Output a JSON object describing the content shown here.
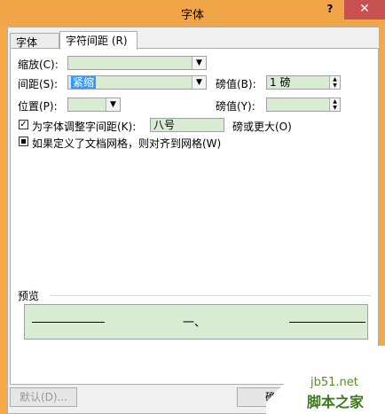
{
  "window": {
    "title": "字体",
    "help": "?",
    "close": "✕"
  },
  "tabs": [
    {
      "label": "字体 (N)"
    },
    {
      "label": "字符间距 (R)"
    }
  ],
  "fields": {
    "scale_label": "缩放(C):",
    "scale_value": "",
    "spacing_label": "间距(S):",
    "spacing_value": "紧缩",
    "spacing_by_label": "磅值(B):",
    "spacing_by_value": "1 磅",
    "position_label": "位置(P):",
    "position_value": "",
    "position_by_label": "磅值(Y):",
    "position_by_value": ""
  },
  "kerning": {
    "label": "为字体调整字间距(K):",
    "value": "八号",
    "suffix": "磅或更大(O)",
    "checked": "✓"
  },
  "snap": {
    "label": "如果定义了文档网格，则对齐到网格(W)"
  },
  "preview": {
    "label": "预览",
    "text": "一、"
  },
  "buttons": {
    "default": "默认(D)...",
    "ok": "确"
  },
  "watermark": {
    "site": "jb51.net",
    "brand": "脚本之家"
  },
  "icons": {
    "dropdown": "▼",
    "up": "▲",
    "down": "▼"
  }
}
